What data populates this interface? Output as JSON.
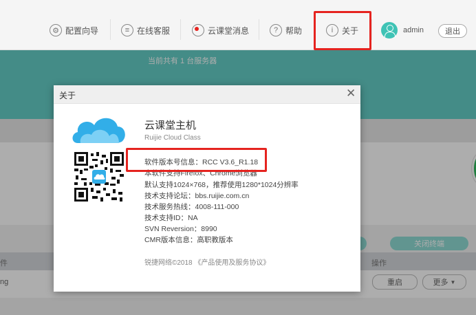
{
  "topbar": {
    "nav": [
      {
        "label": "配置向导",
        "icon": "gear-icon"
      },
      {
        "label": "在线客服",
        "icon": "list-icon"
      },
      {
        "label": "云课堂消息",
        "icon": "message-icon"
      },
      {
        "label": "帮助",
        "icon": "help-icon"
      },
      {
        "label": "关于",
        "icon": "info-icon"
      }
    ],
    "user": "admin",
    "logout_label": "退出"
  },
  "background": {
    "server_count_text": "当前共有 1 台服务器",
    "table_header": {
      "col1": "件",
      "actions": "操作"
    },
    "row": {
      "name": "ng",
      "restart_label": "重启",
      "more_label": "更多"
    },
    "batch_btn_label": "关闭终端"
  },
  "dialog": {
    "title": "关于",
    "product_name": "云课堂主机",
    "product_en": "Ruijie Cloud Class",
    "info": [
      "软件版本号信息：RCC V3.6_R1.18",
      "本软件支持Firefox、Chrome浏览器",
      "默认支持1024×768，推荐使用1280*1024分辨率",
      "技术支持论坛：bbs.ruijie.com.cn",
      "技术服务热线：4008-111-000",
      "技术支持ID：NA",
      "SVN Reversion：8990",
      "CMR版本信息：高职教版本"
    ],
    "copyright": "锐捷网络©2018 《产品使用及服务协议》"
  },
  "colors": {
    "accent": "#65cfc7",
    "highlight": "#e5231f",
    "logo": "#32aee8"
  }
}
